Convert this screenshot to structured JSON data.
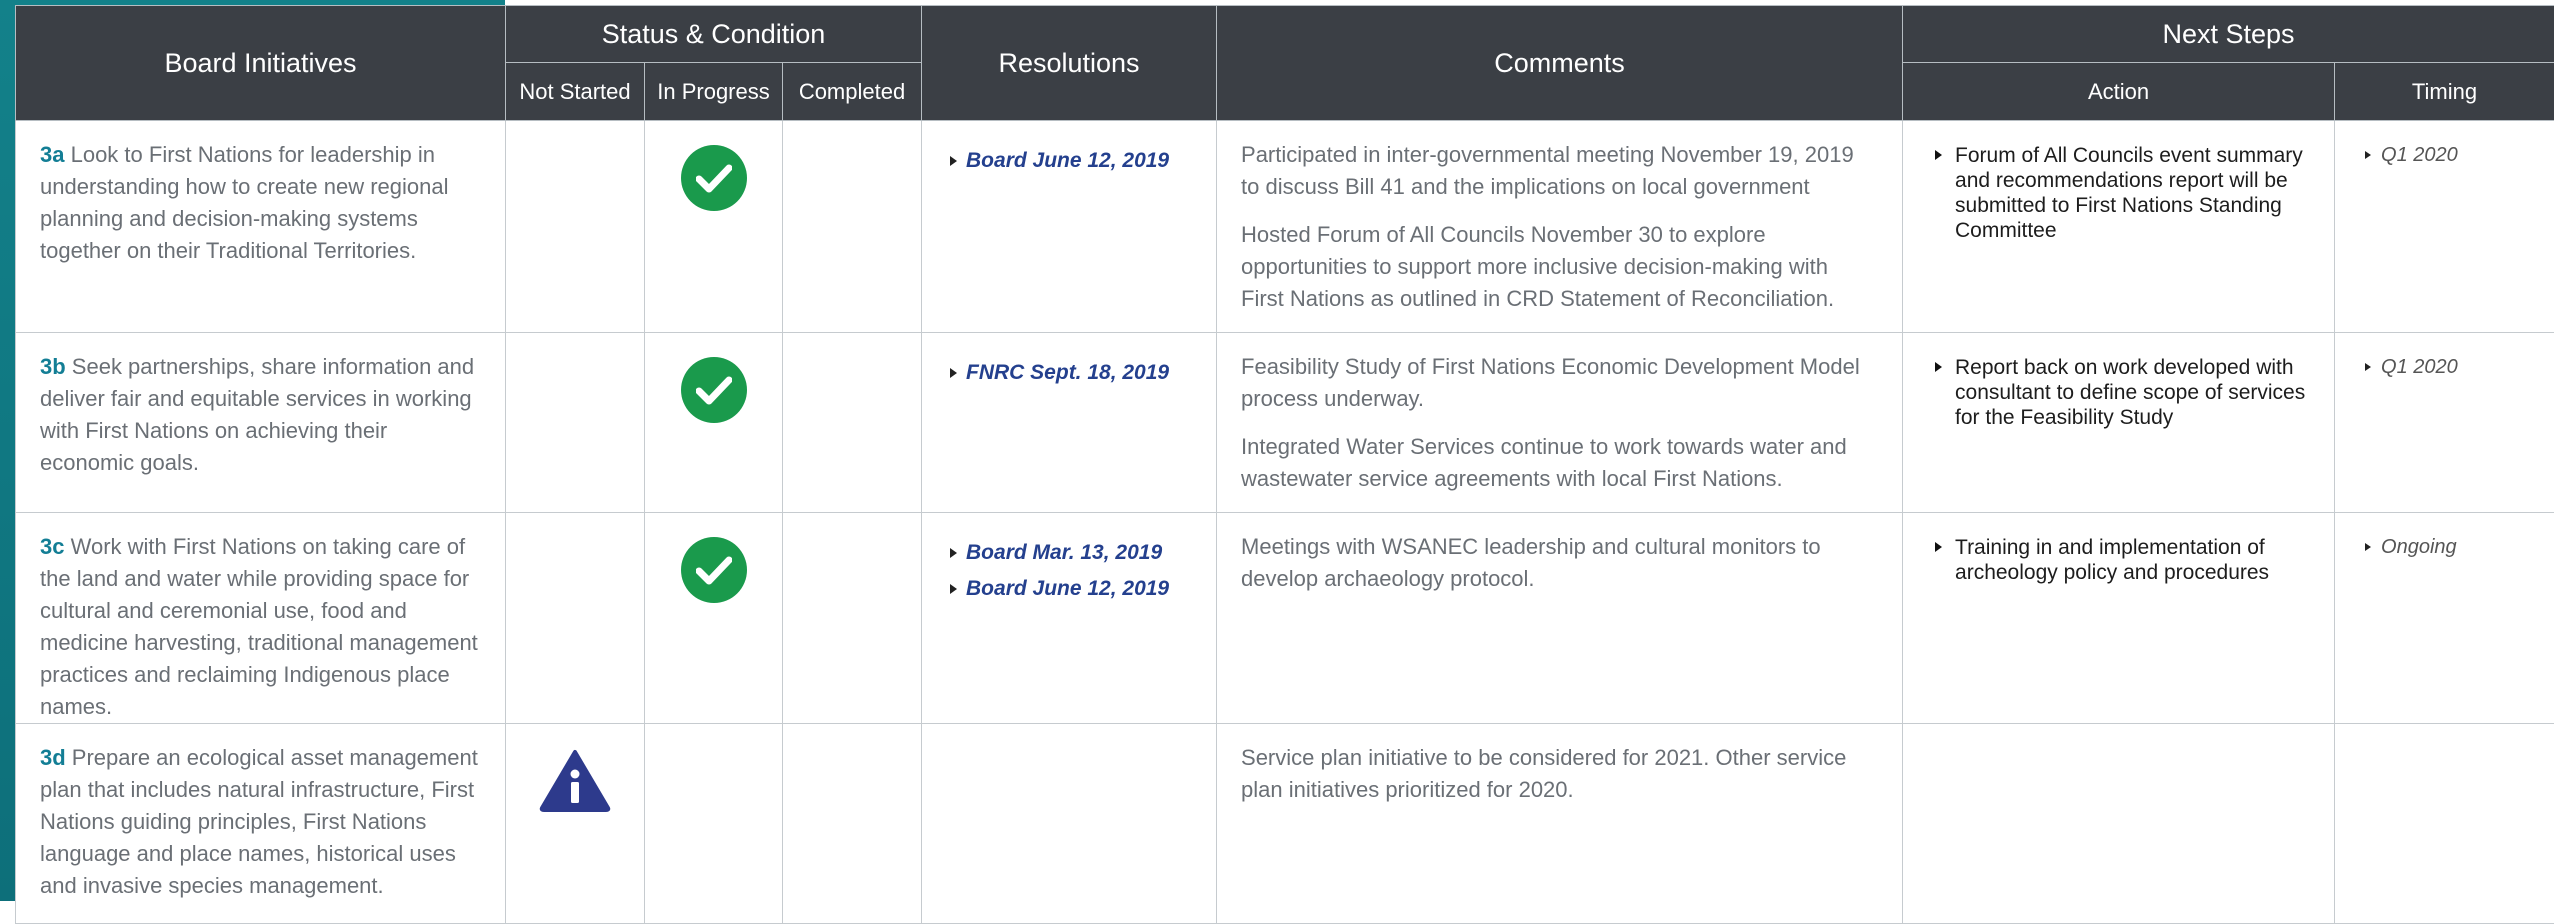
{
  "header": {
    "initiatives": "Board Initiatives",
    "status_group": "Status & Condition",
    "not_started": "Not Started",
    "in_progress": "In Progress",
    "completed": "Completed",
    "resolutions": "Resolutions",
    "comments": "Comments",
    "next_steps": "Next Steps",
    "action": "Action",
    "timing": "Timing"
  },
  "colors": {
    "header_bg": "#3b3f45",
    "accent_teal": "#137e95",
    "check_green": "#1a9a4c",
    "info_blue": "#2d3a8c",
    "resolution_blue": "#24408e"
  },
  "rows": [
    {
      "code": "3a",
      "text": " Look to First Nations for leadership in understanding how to create new regional planning and decision-making systems together on their Traditional Territories.",
      "status": "in_progress",
      "status_icon": "check-circle-icon",
      "resolutions": [
        "Board June 12, 2019"
      ],
      "comments": [
        "Participated in inter-governmental meeting November 19, 2019 to discuss Bill 41 and the implications on local government",
        "Hosted Forum of All Councils November 30 to explore opportunities to support more inclusive decision-making with First Nations as outlined in CRD Statement of Reconciliation."
      ],
      "actions": [
        "Forum of All Councils event summary and recommendations report will be submitted to First Nations Standing Committee"
      ],
      "timing": [
        "Q1 2020"
      ]
    },
    {
      "code": "3b",
      "text": " Seek partnerships, share information and deliver fair and equitable services in working with First Nations on achieving their economic goals.",
      "status": "in_progress",
      "status_icon": "check-circle-icon",
      "resolutions": [
        "FNRC Sept. 18, 2019"
      ],
      "comments": [
        "Feasibility Study of First Nations Economic Development Model process underway.",
        "Integrated Water Services continue to work towards water and wastewater service agreements with local First Nations."
      ],
      "actions": [
        "Report back on work developed with consultant to define scope of services for the Feasibility Study"
      ],
      "timing": [
        "Q1 2020"
      ]
    },
    {
      "code": "3c",
      "text": " Work with First Nations on taking care of the land and water while providing space for cultural and ceremonial use, food and medicine harvesting, traditional management practices and reclaiming Indigenous place names.",
      "status": "in_progress",
      "status_icon": "check-circle-icon",
      "resolutions": [
        "Board Mar. 13, 2019",
        "Board June 12, 2019"
      ],
      "comments": [
        "Meetings with WSANEC leadership and cultural monitors to develop archaeology protocol."
      ],
      "actions": [
        "Training in and implementation of archeology policy and procedures"
      ],
      "timing": [
        "Ongoing"
      ]
    },
    {
      "code": "3d",
      "text": " Prepare an ecological asset management plan that includes natural infrastructure, First Nations guiding principles, First Nations language and place names, historical uses and invasive species management.",
      "status": "not_started",
      "status_icon": "info-triangle-icon",
      "resolutions": [],
      "comments": [
        "Service plan initiative to be considered for 2021. Other service plan initiatives prioritized for 2020."
      ],
      "actions": [],
      "timing": []
    }
  ]
}
